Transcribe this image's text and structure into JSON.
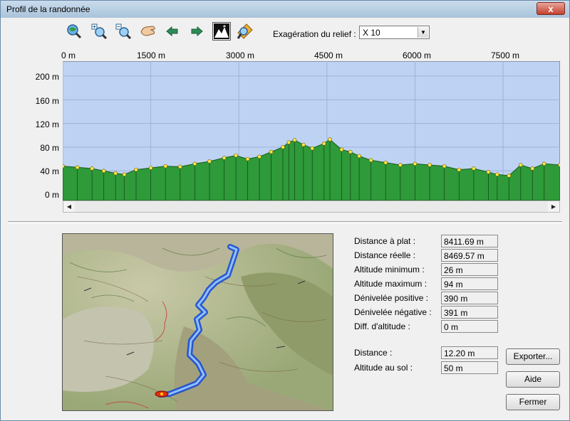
{
  "window": {
    "title": "Profil de la randonnée",
    "close_label": "x"
  },
  "toolbar": {
    "buttons": [
      "zoom-fit-icon",
      "zoom-in-icon",
      "zoom-out-icon",
      "pan-hand-icon",
      "arrow-left-icon",
      "arrow-right-icon",
      "relief-view-icon",
      "locate-icon"
    ],
    "relief_label": "Exagération du relief :",
    "relief_value": "X 10"
  },
  "colors": {
    "plot_bg": "#bed3f4",
    "terrain": "#2e9a39",
    "marker": "#ffe94a",
    "track": "#4a86ff"
  },
  "chart_data": {
    "type": "area",
    "x_ticks": [
      "0 m",
      "1500 m",
      "3000 m",
      "4500 m",
      "6000 m",
      "7500 m"
    ],
    "y_ticks": [
      "200 m",
      "160 m",
      "120 m",
      "80 m",
      "40 m",
      "0 m"
    ],
    "xlim": [
      0,
      8470
    ],
    "ylim": [
      -10,
      225
    ],
    "grid": true,
    "x": [
      0,
      250,
      500,
      700,
      900,
      1050,
      1250,
      1500,
      1750,
      2000,
      2250,
      2500,
      2750,
      2950,
      3150,
      3350,
      3550,
      3750,
      3850,
      3950,
      4100,
      4250,
      4450,
      4550,
      4750,
      4900,
      5050,
      5250,
      5500,
      5750,
      6000,
      6250,
      6500,
      6750,
      7000,
      7250,
      7400,
      7600,
      7800,
      8000,
      8200,
      8470
    ],
    "y": [
      48,
      46,
      44,
      40,
      36,
      34,
      42,
      45,
      48,
      47,
      52,
      56,
      62,
      66,
      60,
      64,
      72,
      80,
      88,
      92,
      84,
      78,
      86,
      93,
      76,
      72,
      65,
      58,
      54,
      50,
      52,
      50,
      48,
      42,
      44,
      38,
      34,
      32,
      50,
      44,
      52,
      50
    ]
  },
  "stats": [
    {
      "label": "Distance à plat :",
      "value": "8411.69 m"
    },
    {
      "label": "Distance réelle :",
      "value": "8469.57 m"
    },
    {
      "label": "Altitude minimum :",
      "value": "26 m"
    },
    {
      "label": "Altitude maximum :",
      "value": "94 m"
    },
    {
      "label": "Dénivelée positive :",
      "value": "390 m"
    },
    {
      "label": "Dénivelée négative :",
      "value": "391 m"
    },
    {
      "label": "Diff. d'altitude :",
      "value": "0 m"
    }
  ],
  "cursor": [
    {
      "label": "Distance :",
      "value": "12.20 m"
    },
    {
      "label": "Altitude au sol :",
      "value": "50 m"
    }
  ],
  "buttons": {
    "export": "Exporter...",
    "help": "Aide",
    "close": "Fermer"
  }
}
